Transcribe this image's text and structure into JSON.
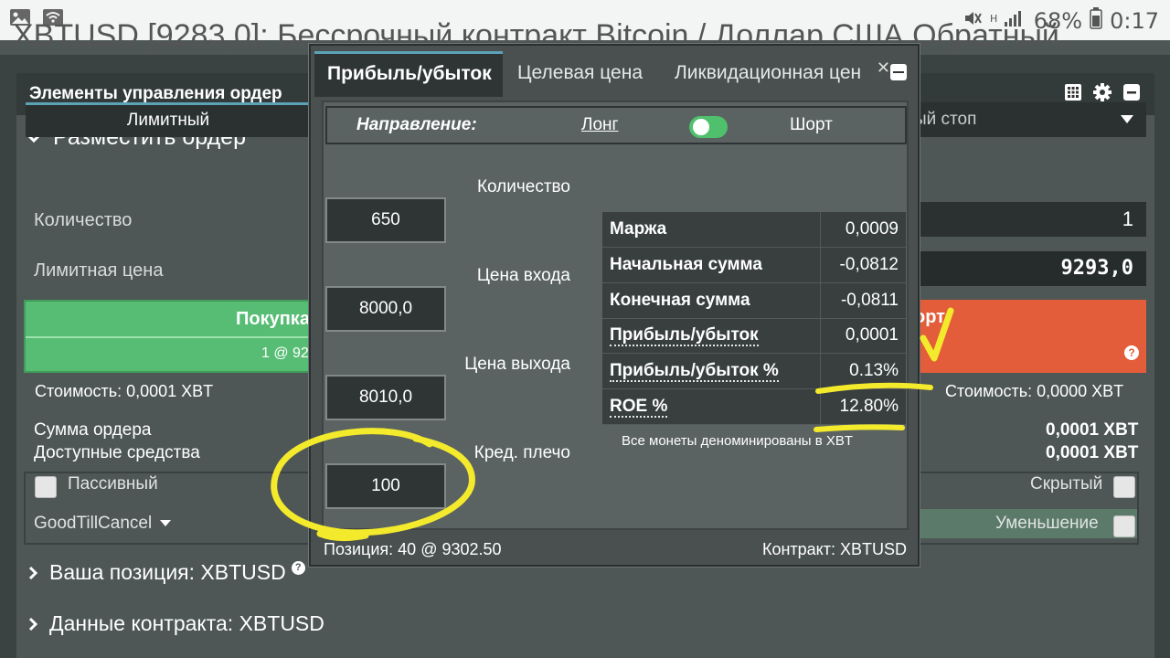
{
  "status_bar": {
    "battery_pct": "68%",
    "time": "0:17"
  },
  "page_title": "XBTUSD [9283,0]: Бессрочный контракт Bitcoin / Доллар США Обратный",
  "panel": {
    "title": "Элементы управления ордер",
    "section_place_order": "Разместить ордер",
    "order_tab_limit": "Лимитный",
    "order_type_right": "ый стоп",
    "quantity_label": "Количество",
    "quantity_value": "1",
    "limit_price_label": "Лимитная цена",
    "limit_price_value": "9293,0",
    "buy_label": "Покупка",
    "buy_sub": "1 @ 92",
    "sell_label": "орт",
    "cost_left": "Стоимость: 0,0001 XBT",
    "cost_right": "Стоимость: 0,0000 XBT",
    "order_sum_label": "Сумма ордера",
    "order_sum_value": "0,0001 XBT",
    "available_label": "Доступные средства",
    "available_value": "0,0001 XBT",
    "passive_label": "Пассивный",
    "hidden_label": "Скрытый",
    "tif_value": "GoodTillCancel",
    "reduce_label": "Уменьшение",
    "section_position": "Ваша позиция: XBTUSD",
    "section_contract": "Данные контракта: XBTUSD"
  },
  "calculator": {
    "tabs": [
      "Прибыль/убыток",
      "Целевая цена",
      "Ликвидационная цен"
    ],
    "active_tab": 0,
    "direction_label": "Направление:",
    "direction_long": "Лонг",
    "direction_short": "Шорт",
    "fields": [
      {
        "label": "Количество",
        "value": "650"
      },
      {
        "label": "Цена входа",
        "value": "8000,0"
      },
      {
        "label": "Цена выхода",
        "value": "8010,0"
      },
      {
        "label": "Кред. плечо",
        "value": "100"
      }
    ],
    "results": [
      {
        "label": "Маржа",
        "value": "0,0009"
      },
      {
        "label": "Начальная сумма",
        "value": "-0,0812"
      },
      {
        "label": "Конечная сумма",
        "value": "-0,0811"
      },
      {
        "label": "Прибыль/убыток",
        "value": "0,0001"
      },
      {
        "label": "Прибыль/убыток %",
        "value": "0.13%"
      },
      {
        "label": "ROE %",
        "value": "12.80%"
      }
    ],
    "denomination_note": "Все монеты деноминированы в XBT",
    "footer_position": "Позиция: 40 @ 9302.50",
    "footer_contract": "Контракт: XBTUSD"
  },
  "colors": {
    "buy": "#57bd74",
    "sell": "#e35d3a",
    "accent": "#5ca3b7",
    "highlighter": "#f4ea2c"
  }
}
